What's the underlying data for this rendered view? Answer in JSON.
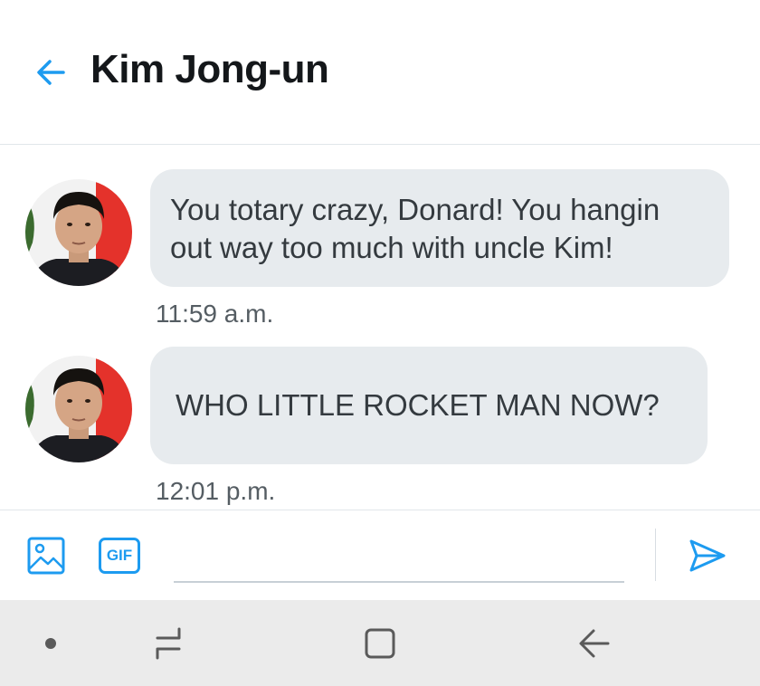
{
  "header": {
    "title": "Kim Jong-un",
    "back_icon": "arrow-left-icon"
  },
  "messages": [
    {
      "text": "You totary crazy, Donard! You hangin out way too much with uncle Kim!",
      "timestamp": "11:59 a.m."
    },
    {
      "text": "WHO LITTLE ROCKET MAN NOW?",
      "timestamp": "12:01 p.m."
    }
  ],
  "composer": {
    "image_icon": "image-icon",
    "gif_label": "GIF",
    "input_value": "",
    "send_icon": "send-icon"
  },
  "navbar": {
    "items": [
      "dot-icon",
      "recent-apps-icon",
      "home-icon",
      "back-icon"
    ]
  },
  "colors": {
    "accent": "#1d9bf0",
    "bubble": "#e7ebee",
    "navbar": "#ebebeb"
  }
}
